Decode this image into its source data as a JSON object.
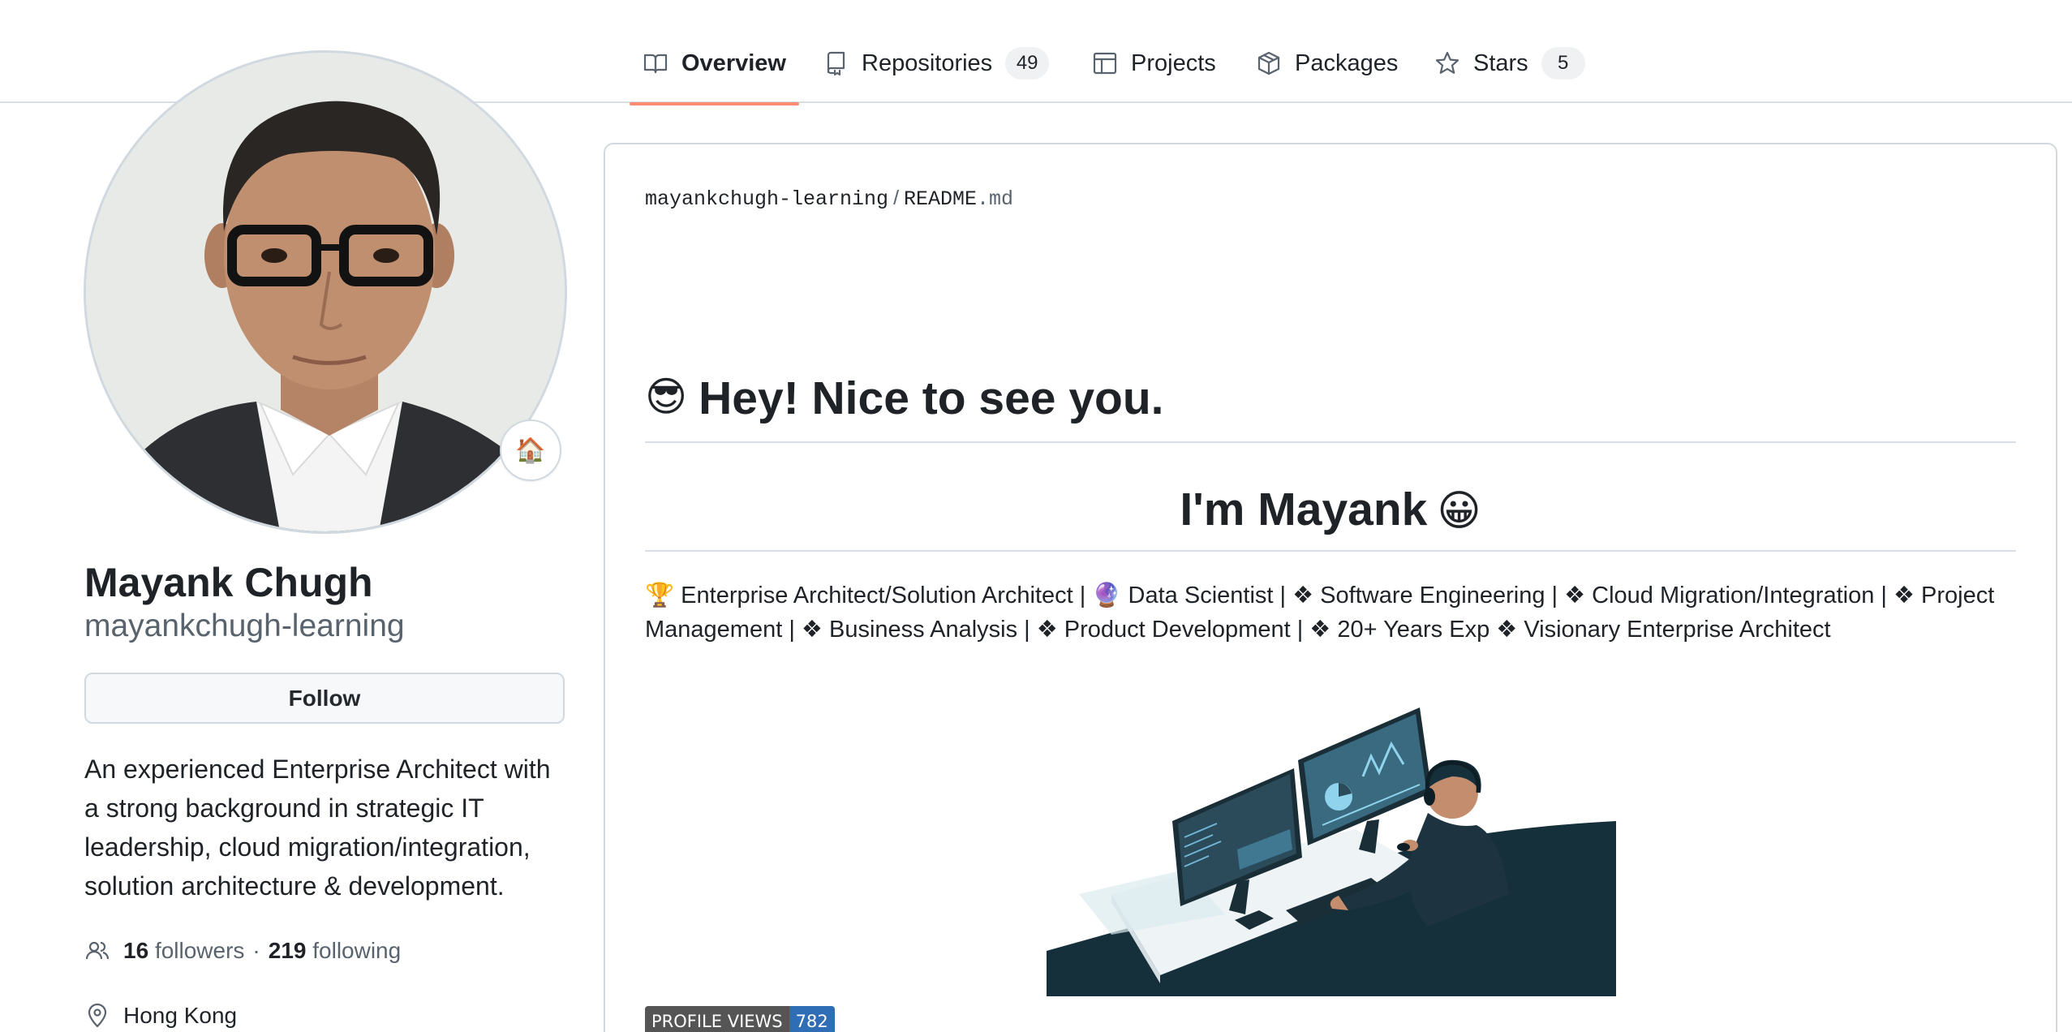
{
  "tabs": [
    {
      "label": "Overview",
      "count": null
    },
    {
      "label": "Repositories",
      "count": "49"
    },
    {
      "label": "Projects",
      "count": null
    },
    {
      "label": "Packages",
      "count": null
    },
    {
      "label": "Stars",
      "count": "5"
    }
  ],
  "profile": {
    "name": "Mayank Chugh",
    "login": "mayankchugh-learning",
    "status_emoji": "🏠",
    "follow_label": "Follow",
    "bio": "An experienced Enterprise Architect with a strong background in strategic IT leadership, cloud migration/integration, solution architecture & development.",
    "followers_count": "16",
    "followers_label": "followers",
    "separator": "·",
    "following_count": "219",
    "following_label": "following",
    "location": "Hong Kong"
  },
  "readme": {
    "owner": "mayankchugh-learning",
    "crumb_separator": "/",
    "file_name": "README",
    "file_ext": ".md",
    "heading_emoji": "😎",
    "heading": "Hey! Nice to see you.",
    "subheading": "I'm Mayank",
    "subheading_emoji": "😀",
    "tagline": "🏆 Enterprise Architect/Solution Architect | 🔮 Data Scientist | ❖ Software Engineering | ❖ Cloud Migration/Integration | ❖ Project Management | ❖ Business Analysis | ❖ Product Development | ❖ 20+ Years Exp ❖ Visionary Enterprise Architect",
    "badge_label": "PROFILE VIEWS",
    "badge_value": "782"
  },
  "colors": {
    "tab_underline": "#fd8c73",
    "badge_value_bg": "#2f6db5",
    "badge_label_bg": "#555555",
    "illustration_dark": "#15303b"
  },
  "icons": {
    "overview": "book-icon",
    "repositories": "repo-icon",
    "projects": "table-icon",
    "packages": "package-icon",
    "stars": "star-icon",
    "followers": "people-icon",
    "location": "location-pin-icon"
  }
}
